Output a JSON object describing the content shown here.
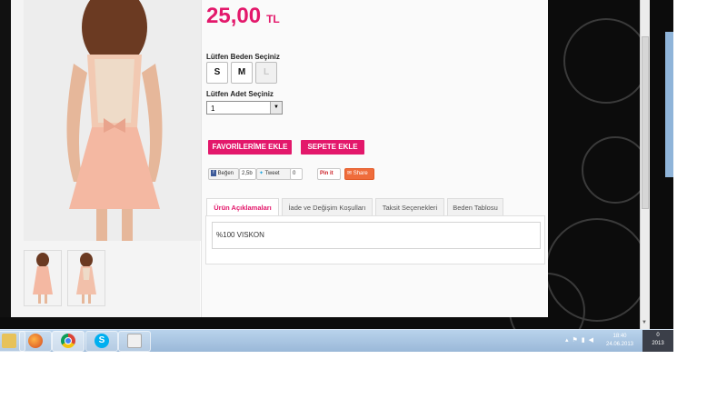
{
  "product": {
    "price": "25,00",
    "currency": "TL",
    "size_label": "Lütfen Beden Seçiniz",
    "sizes": [
      "S",
      "M",
      "L"
    ],
    "qty_label": "Lütfen Adet Seçiniz",
    "qty_value": "1",
    "fav_button": "FAVORİLERİME EKLE",
    "cart_button": "SEPETE EKLE"
  },
  "social": {
    "like": "Beğen",
    "like_count": "2,5b",
    "tweet": "Tweet",
    "tweet_count": "0",
    "pinit": "Pin it",
    "share": "Share"
  },
  "tabs": [
    {
      "label": "Ürün Açıklamaları"
    },
    {
      "label": "İade ve Değişim Koşulları"
    },
    {
      "label": "Taksit Seçenekleri"
    },
    {
      "label": "Beden Tablosu"
    }
  ],
  "tab_content": "%100 VISKON",
  "taskbar": {
    "time": "18:40",
    "date": "24.06.2013",
    "right_top": "0",
    "right_bottom": "2013"
  },
  "colors": {
    "accent": "#e3186b",
    "taskbar": "#a6c3e2"
  }
}
